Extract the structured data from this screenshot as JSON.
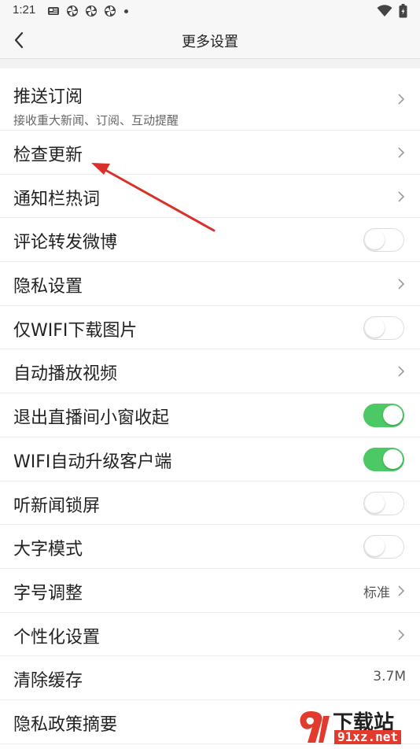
{
  "status_bar": {
    "time": "1:21",
    "icons": [
      "news-app-icon",
      "pinwheel-icon",
      "pinwheel-icon",
      "pinwheel-icon",
      "dot-icon"
    ],
    "right_icons": [
      "wifi-icon",
      "battery-icon"
    ]
  },
  "header": {
    "back_icon": "chevron-left-icon",
    "title": "更多设置"
  },
  "settings": {
    "push": {
      "title": "推送订阅",
      "subtitle": "接收重大新闻、订阅、互动提醒"
    },
    "check_update": {
      "title": "检查更新"
    },
    "notify_hotwords": {
      "title": "通知栏热词"
    },
    "weibo_comment": {
      "title": "评论转发微博",
      "toggle": "off"
    },
    "privacy": {
      "title": "隐私设置"
    },
    "wifi_images": {
      "title": "仅WIFI下载图片",
      "toggle": "off"
    },
    "autoplay": {
      "title": "自动播放视频"
    },
    "live_window": {
      "title": "退出直播间小窗收起",
      "toggle": "on"
    },
    "wifi_upgrade": {
      "title": "WIFI自动升级客户端",
      "toggle": "on"
    },
    "lockscreen": {
      "title": "听新闻锁屏",
      "toggle": "off"
    },
    "large_text": {
      "title": "大字模式",
      "toggle": "off"
    },
    "font_size": {
      "title": "字号调整",
      "value": "标准"
    },
    "personalize": {
      "title": "个性化设置"
    },
    "clear_cache": {
      "title": "清除缓存",
      "value": "3.7M"
    },
    "privacy_summary": {
      "title": "隐私政策摘要"
    }
  },
  "colors": {
    "toggle_on": "#4cc864",
    "annotation_arrow": "#d9302a"
  },
  "watermark": {
    "logo_text": "下载站",
    "url": "91xz.net"
  }
}
